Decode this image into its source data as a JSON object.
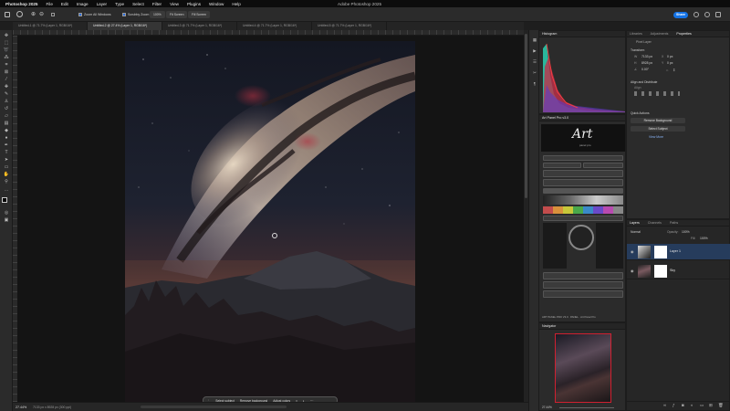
{
  "menubar": {
    "app": "Photoshop 2025",
    "items": [
      "File",
      "Edit",
      "Image",
      "Layer",
      "Type",
      "Select",
      "Filter",
      "View",
      "Plugins",
      "Window",
      "Help"
    ],
    "window_title": "Adobe Photoshop 2025"
  },
  "options": {
    "zoom_all_label": "Zoom All Windows",
    "scrubby_label": "Scrubby Zoom",
    "percent_btn": "100%",
    "fit_label": "Fit Screen",
    "fill_label": "Fill Screen",
    "share_label": "Share"
  },
  "tabs": [
    "Untitled-1 @ 71.7% (Layer 1, RGB/16*)",
    "Untitled-2 @ 27.4% (Layer 1, RGB/16*)",
    "Untitled-3 @ 71.7% (Layer 1, RGB/16*)",
    "Untitled-4 @ 71.7% (Layer 1, RGB/16*)",
    "Untitled-5 @ 71.7% (Layer 1, RGB/16*)"
  ],
  "active_tab_index": 1,
  "status": {
    "zoom": "27.44%",
    "doc_size": "7133 px x 8928 px (300 ppi)"
  },
  "contextbar": {
    "select_subject": "Select subject",
    "remove_bg": "Remove background",
    "adjust_colors": "Adjust colors"
  },
  "histogram": {
    "title": "Histogram"
  },
  "artpanel": {
    "title": "Art Panel Pro v3.0",
    "logo_text": "Art",
    "logo_sub": "panel pro",
    "footer": "ART PANEL PRO V3.0 · PANEL · Art Panel Pro"
  },
  "navigator": {
    "title": "Navigator",
    "zoom": "27.44%"
  },
  "properties": {
    "tabs": [
      "Libraries",
      "Adjustments",
      "Properties"
    ],
    "active_tab": "Properties",
    "pixel_layer": "Pixel Layer",
    "transform_title": "Transform",
    "w": "7133 px",
    "h": "8928 px",
    "x": "0 px",
    "y": "0 px",
    "angle": "0.00°",
    "align_title": "Align and Distribute",
    "align_sub": "Align",
    "quick_title": "Quick Actions",
    "remove_bg": "Remove Background",
    "select_subject": "Select Subject",
    "view_more": "View More"
  },
  "layers": {
    "tabs": [
      "Layers",
      "Channels",
      "Paths"
    ],
    "active_tab": "Layers",
    "blend_mode": "Normal",
    "opacity_label": "Opacity:",
    "opacity": "100%",
    "fill_label": "Fill:",
    "fill": "100%",
    "items": [
      {
        "name": "Layer 1",
        "selected": true
      },
      {
        "name": "Sky",
        "selected": false
      }
    ]
  },
  "colors": {
    "accent": "#1473e6",
    "selected_layer": "#263c5c"
  }
}
